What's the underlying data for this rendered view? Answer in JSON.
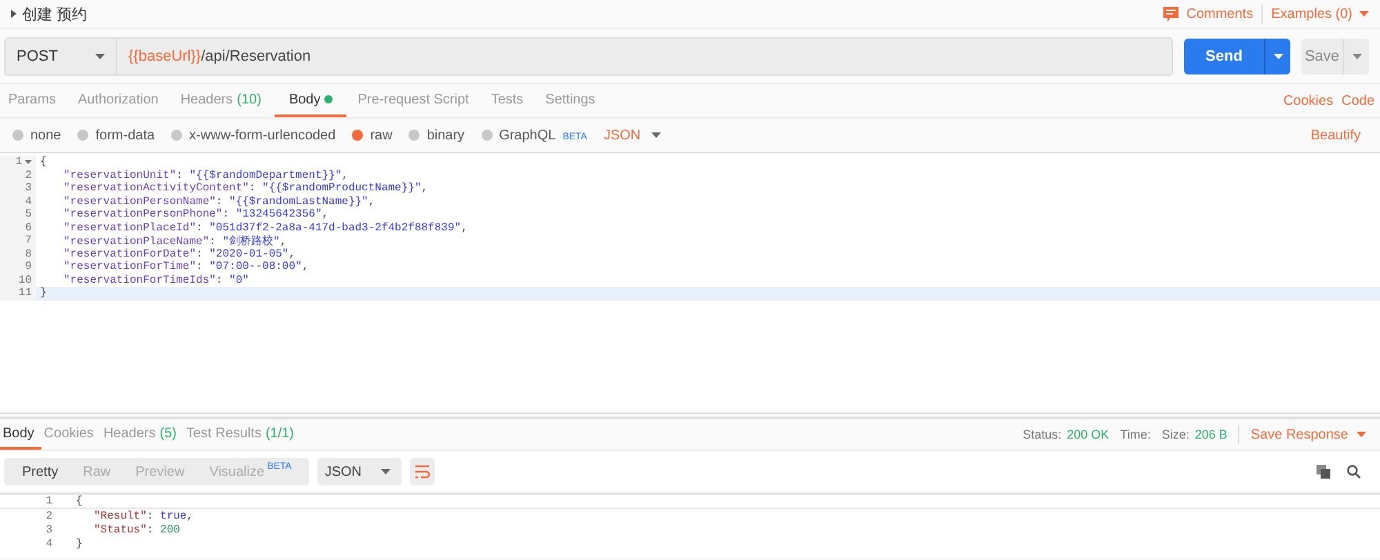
{
  "header": {
    "title": "创建 预约",
    "comments": "Comments",
    "examples": "Examples (0)"
  },
  "request": {
    "method": "POST",
    "url_variable": "{{baseUrl}}",
    "url_path": "/api/Reservation",
    "send": "Send",
    "save": "Save"
  },
  "request_tabs": [
    {
      "label": "Params",
      "selected": false,
      "has_content": false
    },
    {
      "label": "Authorization",
      "selected": false,
      "has_content": false
    },
    {
      "label": "Headers",
      "count": "(10)",
      "selected": false,
      "has_content": false
    },
    {
      "label": "Body",
      "selected": true,
      "has_content": true
    },
    {
      "label": "Pre-request Script",
      "selected": false,
      "has_content": false
    },
    {
      "label": "Tests",
      "selected": false,
      "has_content": false
    },
    {
      "label": "Settings",
      "selected": false,
      "has_content": false
    }
  ],
  "request_links": [
    "Cookies",
    "Code"
  ],
  "body_types": [
    {
      "label": "none",
      "selected": false
    },
    {
      "label": "form-data",
      "selected": false
    },
    {
      "label": "x-www-form-urlencoded",
      "selected": false
    },
    {
      "label": "raw",
      "selected": true
    },
    {
      "label": "binary",
      "selected": false
    },
    {
      "label": "GraphQL",
      "selected": false,
      "badge": "BETA"
    }
  ],
  "body_format": "JSON",
  "beautify": "Beautify",
  "request_body": [
    {
      "number": "1",
      "kind": "brace",
      "foldable": true,
      "active": false,
      "tokens": [
        {
          "kind": "punct",
          "text": "{"
        }
      ]
    },
    {
      "number": "2",
      "kind": "member",
      "foldable": false,
      "active": false,
      "tokens": [
        {
          "kind": "key",
          "text": "\"reservationUnit\""
        },
        {
          "kind": "punct",
          "text": ": "
        },
        {
          "kind": "string",
          "text": "\"{{$randomDepartment}}\""
        },
        {
          "kind": "punct",
          "text": ","
        }
      ]
    },
    {
      "number": "3",
      "kind": "member",
      "foldable": false,
      "active": false,
      "tokens": [
        {
          "kind": "key",
          "text": "\"reservationActivityContent\""
        },
        {
          "kind": "punct",
          "text": ": "
        },
        {
          "kind": "string",
          "text": "\"{{$randomProductName}}\""
        },
        {
          "kind": "punct",
          "text": ","
        }
      ]
    },
    {
      "number": "4",
      "kind": "member",
      "foldable": false,
      "active": false,
      "tokens": [
        {
          "kind": "key",
          "text": "\"reservationPersonName\""
        },
        {
          "kind": "punct",
          "text": ": "
        },
        {
          "kind": "string",
          "text": "\"{{$randomLastName}}\""
        },
        {
          "kind": "punct",
          "text": ","
        }
      ]
    },
    {
      "number": "5",
      "kind": "member",
      "foldable": false,
      "active": false,
      "tokens": [
        {
          "kind": "key",
          "text": "\"reservationPersonPhone\""
        },
        {
          "kind": "punct",
          "text": ": "
        },
        {
          "kind": "string",
          "text": "\"13245642356\""
        },
        {
          "kind": "punct",
          "text": ","
        }
      ]
    },
    {
      "number": "6",
      "kind": "member",
      "foldable": false,
      "active": false,
      "tokens": [
        {
          "kind": "key",
          "text": "\"reservationPlaceId\""
        },
        {
          "kind": "punct",
          "text": ": "
        },
        {
          "kind": "string",
          "text": "\"051d37f2-2a8a-417d-bad3-2f4b2f88f839\""
        },
        {
          "kind": "punct",
          "text": ","
        }
      ]
    },
    {
      "number": "7",
      "kind": "member",
      "foldable": false,
      "active": false,
      "tokens": [
        {
          "kind": "key",
          "text": "\"reservationPlaceName\""
        },
        {
          "kind": "punct",
          "text": ": "
        },
        {
          "kind": "string",
          "text": "\"剑桥路校\""
        },
        {
          "kind": "punct",
          "text": ","
        }
      ]
    },
    {
      "number": "8",
      "kind": "member",
      "foldable": false,
      "active": false,
      "tokens": [
        {
          "kind": "key",
          "text": "\"reservationForDate\""
        },
        {
          "kind": "punct",
          "text": ": "
        },
        {
          "kind": "string",
          "text": "\"2020-01-05\""
        },
        {
          "kind": "punct",
          "text": ","
        }
      ]
    },
    {
      "number": "9",
      "kind": "member",
      "foldable": false,
      "active": false,
      "tokens": [
        {
          "kind": "key",
          "text": "\"reservationForTime\""
        },
        {
          "kind": "punct",
          "text": ": "
        },
        {
          "kind": "string",
          "text": "\"07:00--08:00\""
        },
        {
          "kind": "punct",
          "text": ","
        }
      ]
    },
    {
      "number": "10",
      "kind": "member",
      "foldable": false,
      "active": false,
      "tokens": [
        {
          "kind": "key",
          "text": "\"reservationForTimeIds\""
        },
        {
          "kind": "punct",
          "text": ": "
        },
        {
          "kind": "string",
          "text": "\"0\""
        }
      ]
    },
    {
      "number": "11",
      "kind": "brace",
      "foldable": false,
      "active": true,
      "tokens": [
        {
          "kind": "punct",
          "text": "}"
        }
      ]
    }
  ],
  "response_tabs": [
    {
      "label": "Body",
      "selected": true
    },
    {
      "label": "Cookies",
      "selected": false
    },
    {
      "label": "Headers",
      "count": "(5)",
      "selected": false
    },
    {
      "label": "Test Results",
      "count": "(1/1)",
      "selected": false
    }
  ],
  "response_status": [
    {
      "label": "Status:",
      "value": "200 OK"
    },
    {
      "label": "Time:"
    },
    {
      "label": "Size:",
      "value": "206 B"
    }
  ],
  "save_response": "Save Response",
  "view_modes": [
    {
      "label": "Pretty",
      "selected": true
    },
    {
      "label": "Raw",
      "selected": false
    },
    {
      "label": "Preview",
      "selected": false
    },
    {
      "label": "Visualize",
      "badge": "BETA",
      "selected": false
    }
  ],
  "response_format": "JSON",
  "response_body": [
    {
      "number": "1",
      "kind": "brace",
      "active": true,
      "tokens": [
        {
          "kind": "punct",
          "text": "{"
        }
      ]
    },
    {
      "number": "2",
      "kind": "member",
      "active": false,
      "tokens": [
        {
          "kind": "rkey",
          "text": "\"Result\""
        },
        {
          "kind": "punct",
          "text": ": "
        },
        {
          "kind": "literal",
          "text": "true"
        },
        {
          "kind": "punct",
          "text": ","
        }
      ]
    },
    {
      "number": "3",
      "kind": "member",
      "active": false,
      "tokens": [
        {
          "kind": "rkey",
          "text": "\"Status\""
        },
        {
          "kind": "punct",
          "text": ": "
        },
        {
          "kind": "number",
          "text": "200"
        }
      ]
    },
    {
      "number": "4",
      "kind": "brace",
      "active": false,
      "tokens": [
        {
          "kind": "punct",
          "text": "}"
        }
      ]
    }
  ]
}
